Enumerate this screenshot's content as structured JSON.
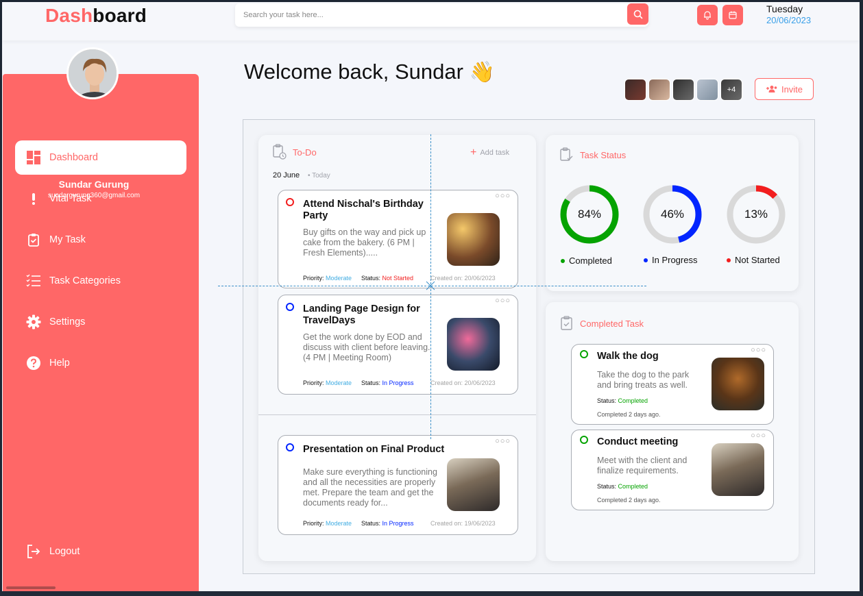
{
  "header": {
    "brand_accent": "Dash",
    "brand_rest": "board",
    "search_placeholder": "Search your task here...",
    "day": "Tuesday",
    "date": "20/06/2023"
  },
  "user": {
    "name": "Sundar Gurung",
    "email": "sundargurung360@gmail.com"
  },
  "sidebar": {
    "items": [
      {
        "label": "Dashboard",
        "icon": "dashboard-icon"
      },
      {
        "label": "Vital Task",
        "icon": "exclamation-icon"
      },
      {
        "label": "My Task",
        "icon": "clipboard-check-icon"
      },
      {
        "label": "Task Categories",
        "icon": "list-icon"
      },
      {
        "label": "Settings",
        "icon": "gear-icon"
      },
      {
        "label": "Help",
        "icon": "help-icon"
      }
    ],
    "logout": "Logout"
  },
  "main": {
    "welcome": "Welcome back, Sundar",
    "wave": "👋",
    "team_more": "+4",
    "invite": "Invite"
  },
  "todo": {
    "title": "To-Do",
    "add_task": "Add task",
    "date": "20 June",
    "today": "• Today",
    "tasks": [
      {
        "title": "Attend Nischal's Birthday Party",
        "desc": "Buy gifts on the way and pick up cake from the bakery. (6 PM | Fresh Elements).....",
        "priority_label": "Priority:",
        "priority": "Moderate",
        "status_label": "Status:",
        "status": "Not Started",
        "created": "Created on: 20/06/2023"
      },
      {
        "title": "Landing Page Design for TravelDays",
        "desc": "Get the work done by EOD and discuss with client before leaving. (4 PM | Meeting Room)",
        "priority_label": "Priority:",
        "priority": "Moderate",
        "status_label": "Status:",
        "status": "In Progress",
        "created": "Created on: 20/06/2023"
      },
      {
        "title": "Presentation on Final Product",
        "desc": "Make sure everything is functioning and all the necessities are properly met. Prepare the team and get the documents ready for...",
        "priority_label": "Priority:",
        "priority": "Moderate",
        "status_label": "Status:",
        "status": "In Progress",
        "created": "Created on: 19/06/2023"
      }
    ]
  },
  "task_status": {
    "title": "Task Status",
    "items": [
      {
        "value": 84,
        "label": "84%",
        "legend": "Completed",
        "color": "#05a301"
      },
      {
        "value": 46,
        "label": "46%",
        "legend": "In Progress",
        "color": "#0225ff"
      },
      {
        "value": 13,
        "label": "13%",
        "legend": "Not Started",
        "color": "#f21e1e"
      }
    ]
  },
  "completed": {
    "title": "Completed Task",
    "tasks": [
      {
        "title": "Walk the dog",
        "desc": "Take the dog to the park and bring treats as well.",
        "status_label": "Status:",
        "status": "Completed",
        "ago": "Completed 2 days ago."
      },
      {
        "title": "Conduct meeting",
        "desc": "Meet with the client and finalize requirements.",
        "status_label": "Status:",
        "status": "Completed",
        "ago": "Completed 2 days ago."
      }
    ]
  },
  "colors": {
    "accent": "#ff6767",
    "moderate": "#42ade2",
    "not_started": "#f21e1e",
    "in_progress": "#0225ff",
    "completed": "#05a301"
  }
}
